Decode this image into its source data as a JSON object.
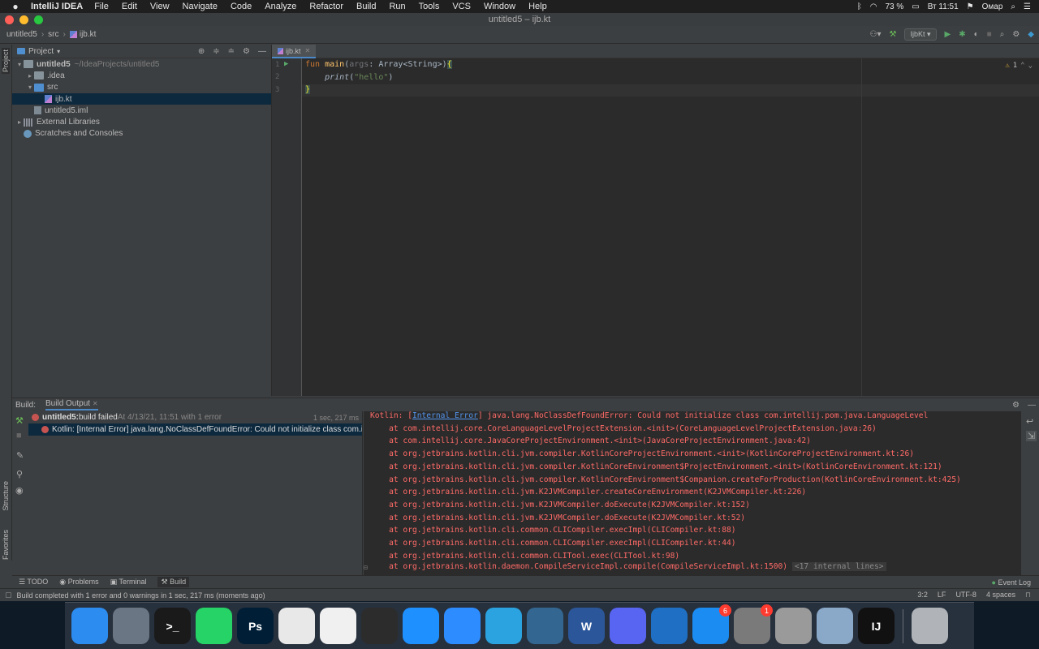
{
  "menubar": {
    "app_name": "IntelliJ IDEA",
    "items": [
      "File",
      "Edit",
      "View",
      "Navigate",
      "Code",
      "Analyze",
      "Refactor",
      "Build",
      "Run",
      "Tools",
      "VCS",
      "Window",
      "Help"
    ],
    "battery": "73 %",
    "clock": "Вт 11:51",
    "user": "Омар"
  },
  "window": {
    "title": "untitled5 – ijb.kt"
  },
  "navbar": {
    "crumbs": [
      "untitled5",
      "src",
      "ijb.kt"
    ],
    "run_config": "IjbKt"
  },
  "project_panel": {
    "title": "Project",
    "tree": [
      {
        "label": "untitled5",
        "path": "~/IdeaProjects/untitled5",
        "indent": 0,
        "arrow": "▾",
        "icon": "folder",
        "bold": true
      },
      {
        "label": ".idea",
        "path": "",
        "indent": 1,
        "arrow": "▸",
        "icon": "folder"
      },
      {
        "label": "src",
        "path": "",
        "indent": 1,
        "arrow": "▾",
        "icon": "folder-blue"
      },
      {
        "label": "ijb.kt",
        "path": "",
        "indent": 2,
        "arrow": "",
        "icon": "kt",
        "selected": true
      },
      {
        "label": "untitled5.iml",
        "path": "",
        "indent": 1,
        "arrow": "",
        "icon": "iml"
      },
      {
        "label": "External Libraries",
        "path": "",
        "indent": 0,
        "arrow": "▸",
        "icon": "lib"
      },
      {
        "label": "Scratches and Consoles",
        "path": "",
        "indent": 0,
        "arrow": "",
        "icon": "scratch"
      }
    ]
  },
  "left_stripe": {
    "project": "Project",
    "structure": "Structure",
    "favorites": "Favorites"
  },
  "editor": {
    "tab_label": "ijb.kt",
    "line_numbers": [
      "1",
      "2",
      "3"
    ],
    "code": {
      "l1_kw": "fun ",
      "l1_fn": "main",
      "l1_open": "(",
      "l1_param": "args",
      "l1_type": ": Array<String>)",
      "l1_brace": "{",
      "l2_fn": "print",
      "l2_open": "(",
      "l2_str": "\"hello\"",
      "l2_close": ")",
      "l3_brace": "}"
    },
    "warnings": "1"
  },
  "build_panel": {
    "header_label": "Build:",
    "tab_label": "Build Output",
    "tree": {
      "root_name": "untitled5:",
      "root_status": " build failed",
      "root_meta": " At 4/13/21, 11:51 with 1 error",
      "root_time": "1 sec, 217 ms",
      "child": "Kotlin: [Internal Error] java.lang.NoClassDefFoundError: Could not initialize class com.intellij.pom.java.LanguageLevel"
    },
    "console": {
      "first_prefix": "Kotlin: [",
      "first_link": "Internal Error",
      "first_suffix": "] java.lang.NoClassDefFoundError: Could not initialize class com.intellij.pom.java.LanguageLevel",
      "stack": [
        "    at com.intellij.core.CoreLanguageLevelProjectExtension.<init>(CoreLanguageLevelProjectExtension.java:26)",
        "    at com.intellij.core.JavaCoreProjectEnvironment.<init>(JavaCoreProjectEnvironment.java:42)",
        "    at org.jetbrains.kotlin.cli.jvm.compiler.KotlinCoreProjectEnvironment.<init>(KotlinCoreProjectEnvironment.kt:26)",
        "    at org.jetbrains.kotlin.cli.jvm.compiler.KotlinCoreEnvironment$ProjectEnvironment.<init>(KotlinCoreEnvironment.kt:121)",
        "    at org.jetbrains.kotlin.cli.jvm.compiler.KotlinCoreEnvironment$Companion.createForProduction(KotlinCoreEnvironment.kt:425)",
        "    at org.jetbrains.kotlin.cli.jvm.K2JVMCompiler.createCoreEnvironment(K2JVMCompiler.kt:226)",
        "    at org.jetbrains.kotlin.cli.jvm.K2JVMCompiler.doExecute(K2JVMCompiler.kt:152)",
        "    at org.jetbrains.kotlin.cli.jvm.K2JVMCompiler.doExecute(K2JVMCompiler.kt:52)",
        "    at org.jetbrains.kotlin.cli.common.CLICompiler.execImpl(CLICompiler.kt:88)",
        "    at org.jetbrains.kotlin.cli.common.CLICompiler.execImpl(CLICompiler.kt:44)",
        "    at org.jetbrains.kotlin.cli.common.CLITool.exec(CLITool.kt:98)"
      ],
      "last_line": "    at org.jetbrains.kotlin.daemon.CompileServiceImpl.compile(CompileServiceImpl.kt:1500)",
      "fold": "<17 internal lines>"
    }
  },
  "tool_tabs": {
    "todo": "TODO",
    "problems": "Problems",
    "terminal": "Terminal",
    "build": "Build",
    "event_log": "Event Log"
  },
  "status_bar": {
    "message": "Build completed with 1 error and 0 warnings in 1 sec, 217 ms (moments ago)",
    "position": "3:2",
    "line_sep": "LF",
    "encoding": "UTF-8",
    "indent": "4 spaces"
  },
  "dock": {
    "apps": [
      {
        "name": "Finder",
        "color": "#2d8cf0",
        "glyph": ""
      },
      {
        "name": "Launchpad",
        "color": "#6b7684",
        "glyph": ""
      },
      {
        "name": "Terminal",
        "color": "#1a1a1a",
        "glyph": ">_"
      },
      {
        "name": "WhatsApp",
        "color": "#25d366",
        "glyph": ""
      },
      {
        "name": "Photoshop",
        "color": "#001e36",
        "glyph": "Ps"
      },
      {
        "name": "Chrome",
        "color": "#e8e8e8",
        "glyph": ""
      },
      {
        "name": "Xcode",
        "color": "#f0f0f0",
        "glyph": ""
      },
      {
        "name": "Figma",
        "color": "#2c2c2c",
        "glyph": ""
      },
      {
        "name": "Safari",
        "color": "#1e90ff",
        "glyph": ""
      },
      {
        "name": "Zoom",
        "color": "#2d8cff",
        "glyph": ""
      },
      {
        "name": "Telegram",
        "color": "#2aa3e0",
        "glyph": ""
      },
      {
        "name": "PostgreSQL",
        "color": "#336791",
        "glyph": ""
      },
      {
        "name": "Word",
        "color": "#2b579a",
        "glyph": "W"
      },
      {
        "name": "Discord",
        "color": "#5865f2",
        "glyph": ""
      },
      {
        "name": "VS Code",
        "color": "#1f6fc5",
        "glyph": ""
      },
      {
        "name": "App Store",
        "color": "#1b8cf2",
        "glyph": "",
        "badge": "6"
      },
      {
        "name": "System Preferences",
        "color": "#7a7a7a",
        "glyph": "",
        "badge": "1"
      },
      {
        "name": "Database",
        "color": "#9a9a9a",
        "glyph": ""
      },
      {
        "name": "Preview",
        "color": "#8aa8c8",
        "glyph": ""
      },
      {
        "name": "IntelliJ IDEA",
        "color": "#111111",
        "glyph": "IJ"
      },
      {
        "name": "Trash",
        "color": "#b0b4b8",
        "glyph": ""
      }
    ]
  }
}
